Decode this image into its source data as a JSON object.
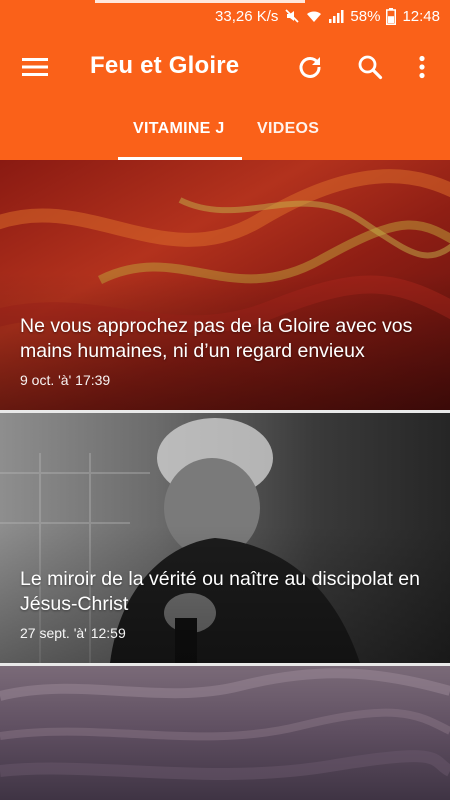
{
  "status_bar": {
    "speed": "33,26 K/s",
    "battery": "58%",
    "time": "12:48",
    "icons": [
      "mute-icon",
      "wifi-icon",
      "signal-icon",
      "battery-icon"
    ]
  },
  "app_bar": {
    "title": "Feu et Gloire",
    "color": "#fa6119",
    "actions": [
      "refresh-icon",
      "search-icon",
      "more-vert-icon"
    ]
  },
  "tabs": [
    {
      "label": "VITAMINE J",
      "selected": true
    },
    {
      "label": "VIDEOS",
      "selected": false
    }
  ],
  "feed": [
    {
      "title": "Ne vous approchez pas de la Gloire avec vos mains humaines, ni d’un regard envieux",
      "date": "9 oct. 'à' 17:39"
    },
    {
      "title": "Le miroir de la vérité ou naître au discipolat en Jésus-Christ",
      "date": "27 sept. 'à' 12:59"
    },
    {
      "title": "",
      "date": ""
    }
  ]
}
